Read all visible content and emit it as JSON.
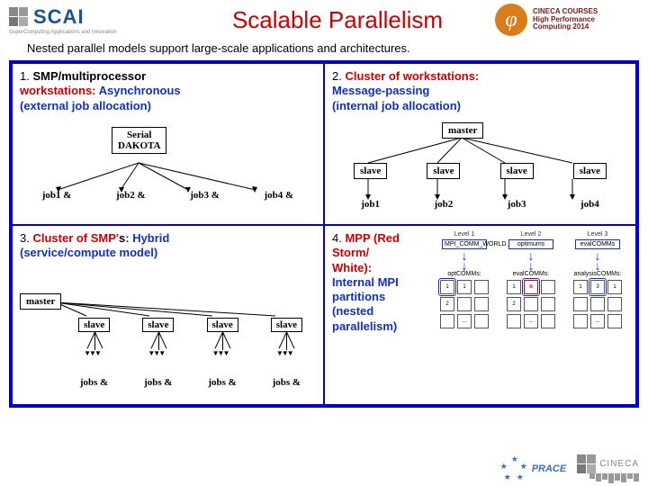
{
  "header": {
    "scai": "SCAI",
    "scai_sub": "SuperComputing Applications and Innovation",
    "title": "Scalable Parallelism",
    "courses_l1": "CINECA COURSES",
    "courses_l2": "High Performance",
    "courses_l3": "Computing 2014"
  },
  "subtitle": "Nested parallel models support large-scale applications and architectures.",
  "q1": {
    "num": "1.",
    "line1": "SMP/multiprocessor",
    "line2a": "workstations:",
    "line2b": " Asynchronous",
    "line3": "(external job allocation)",
    "root1": "Serial",
    "root2": "DAKOTA",
    "j1": "job1 &",
    "j2": "job2 &",
    "j3": "job3 &",
    "j4": "job4 &"
  },
  "q2": {
    "num": "2.",
    "line1": "Cluster of workstations:",
    "line2": "Message-passing",
    "line3": "(internal job allocation)",
    "master": "master",
    "s": "slave",
    "j1": "job1",
    "j2": "job2",
    "j3": "job3",
    "j4": "job4"
  },
  "q3": {
    "num": "3.",
    "line1a": "Cluster of SMP'",
    "line1b": "s",
    "line1c": ": Hybrid",
    "line2": "(service/compute model)",
    "master": "master",
    "s": "slave",
    "jobs": "jobs &"
  },
  "q4": {
    "num": "4.",
    "line1": "MPP (Red",
    "line2": "Storm/",
    "line3": "White):",
    "line4": "Internal MPI",
    "line5": "partitions",
    "line6": "(nested",
    "line7": "parallelism)",
    "lvl1": "Level 1",
    "lvl2": "Level 2",
    "lvl3": "Level 3",
    "m1": "MPI_COMM_WORLD",
    "m2": "optimums",
    "m3": "evalCOMMs",
    "c1": "optCOMMs:",
    "c2": "evalCOMMs:",
    "c3": "analysisCOMMs:",
    "dots": "..."
  },
  "footer": {
    "prace": "PRACE",
    "cineca": "CINECA"
  }
}
